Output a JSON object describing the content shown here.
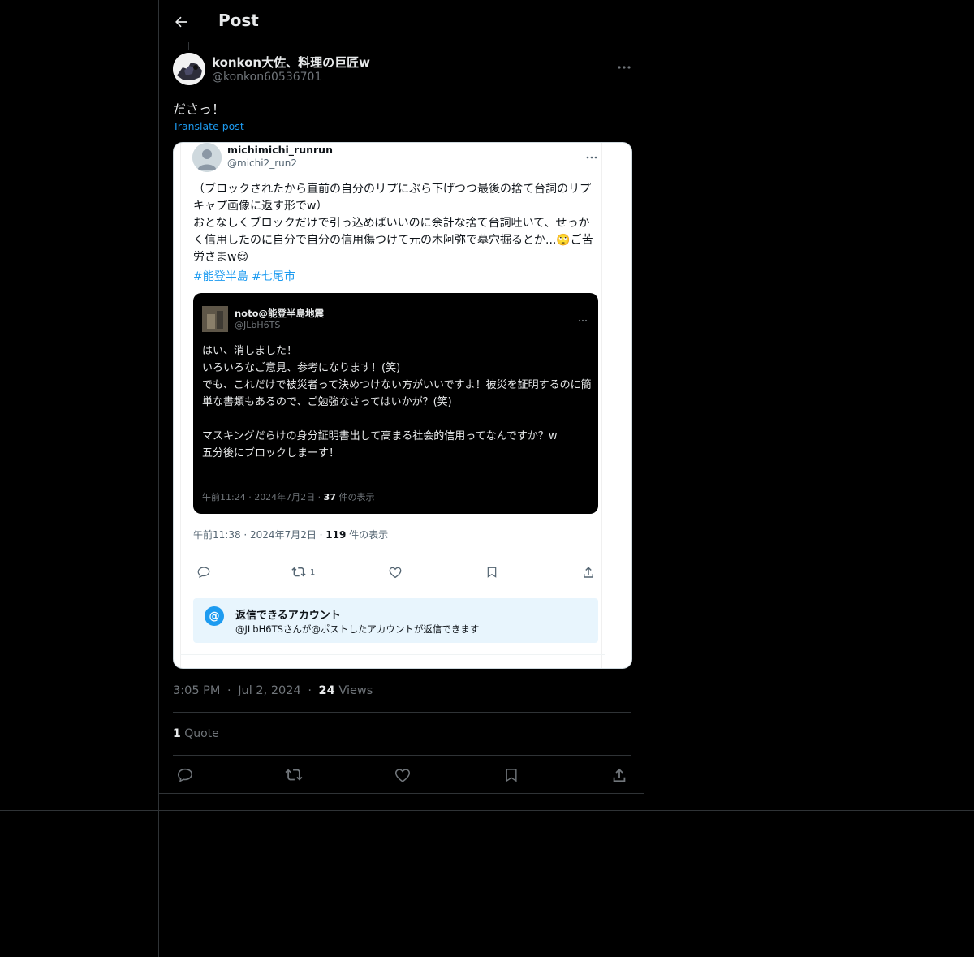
{
  "header": {
    "title": "Post",
    "back_icon": "arrow-left-icon"
  },
  "post": {
    "author_name": "konkon大佐、料理の巨匠w",
    "author_handle": "@konkon60536701",
    "text": "ださっ！",
    "translate_label": "Translate post",
    "time": "3:05 PM",
    "date": "Jul 2, 2024",
    "views_count": "24",
    "views_label": "Views",
    "quote_count": "1",
    "quote_label": "Quote",
    "more_icon": "more-horizontal-icon"
  },
  "screenshot": {
    "name": "michimichi_runrun",
    "handle": "@michi2_run2",
    "body": "（ブロックされたから直前の自分のリプにぶら下げつつ最後の捨て台詞のリプキャプ画像に返す形でw）\nおとなしくブロックだけで引っ込めばいいのに余計な捨て台詞吐いて、せっかく信用したのに自分で自分の信用傷つけて元の木阿弥で墓穴掘るとか...🙄ご苦労さまw😌",
    "tags": "#能登半島 #七尾市",
    "meta_time": "午前11:38 · 2024年7月2日 · ",
    "meta_views": "119",
    "meta_views_label": " 件の表示",
    "retweet_count": "1",
    "reply_box_title": "返信できるアカウント",
    "reply_box_sub": "@JLbH6TSさんが@ポストしたアカウントが返信できます",
    "reply_box_icon": "@",
    "quote": {
      "name": "noto@能登半島地震",
      "handle": "@JLbH6TS",
      "body": "はい、消しました！\nいろいろなご意見、参考になります！(笑)\nでも、これだけで被災者って決めつけない方がいいですよ！被災を証明するのに簡単な書類もあるので、ご勉強なさってはいかが？(笑)\n\nマスキングだらけの身分証明書出して高まる社会的信用ってなんですか？w\n五分後にブロックしまーす！",
      "meta_time": "午前11:24 · 2024年7月2日 · ",
      "meta_views": "37",
      "meta_views_label": " 件の表示"
    }
  },
  "colors": {
    "accent": "#1d9bf0",
    "bg": "#000000",
    "border": "#2f3336",
    "muted": "#71767b"
  }
}
